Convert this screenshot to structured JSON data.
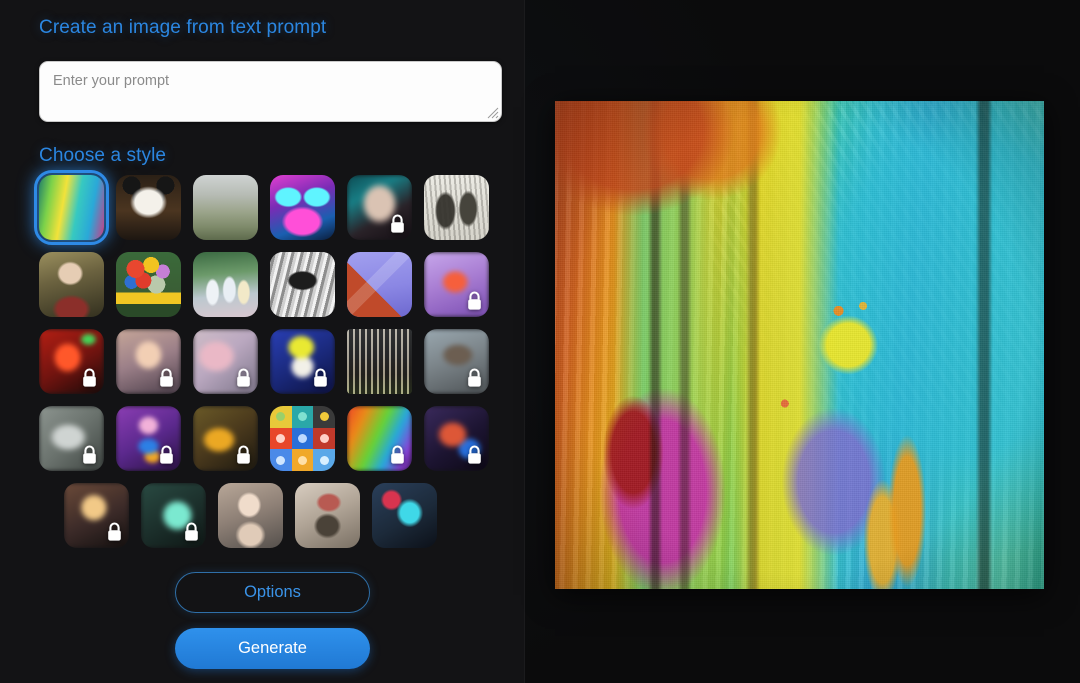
{
  "app": {
    "title": "Create an image from text prompt",
    "background_color": "#0b0b0c",
    "panel_color": "#131315",
    "accent_color": "#2b86e0"
  },
  "prompt": {
    "heading": "Create an image from text prompt",
    "value": "",
    "placeholder": "Enter your prompt",
    "resize_handle_icon": "resize-grip-icon"
  },
  "styles": {
    "heading": "Choose a style",
    "selected_index": 0,
    "lock_icon": "lock-icon",
    "rows": [
      {
        "centered": false,
        "tiles": [
          {
            "name": "abstract-vivid",
            "locked": false,
            "selected": true
          },
          {
            "name": "panda-photo",
            "locked": false,
            "selected": false
          },
          {
            "name": "misty-landscape",
            "locked": false,
            "selected": false
          },
          {
            "name": "neon-robot",
            "locked": false,
            "selected": false
          },
          {
            "name": "dark-portrait",
            "locked": true,
            "selected": false
          },
          {
            "name": "vintage-engraving",
            "locked": false,
            "selected": false
          }
        ]
      },
      {
        "centered": false,
        "tiles": [
          {
            "name": "renaissance-portrait",
            "locked": false,
            "selected": false
          },
          {
            "name": "floral-bouquet",
            "locked": false,
            "selected": false
          },
          {
            "name": "ballet-impressionist",
            "locked": false,
            "selected": false
          },
          {
            "name": "metallic-cup",
            "locked": false,
            "selected": false
          },
          {
            "name": "isometric-3d",
            "locked": false,
            "selected": false
          },
          {
            "name": "pink-fox",
            "locked": true,
            "selected": false
          }
        ]
      },
      {
        "centered": false,
        "tiles": [
          {
            "name": "red-glow-portrait",
            "locked": true,
            "selected": false
          },
          {
            "name": "soft-woman-portrait",
            "locked": true,
            "selected": false
          },
          {
            "name": "pastel-blur",
            "locked": true,
            "selected": false
          },
          {
            "name": "pop-art-face",
            "locked": true,
            "selected": false
          },
          {
            "name": "modern-architecture",
            "locked": false,
            "selected": false
          },
          {
            "name": "muted-still-life",
            "locked": true,
            "selected": false
          }
        ]
      },
      {
        "centered": false,
        "tiles": [
          {
            "name": "grey-texture",
            "locked": true,
            "selected": false
          },
          {
            "name": "neon-jewel-portrait",
            "locked": true,
            "selected": false
          },
          {
            "name": "amber-abstract",
            "locked": true,
            "selected": false
          },
          {
            "name": "icon-set-grid",
            "locked": false,
            "selected": false
          },
          {
            "name": "rainbow-swirl",
            "locked": true,
            "selected": false
          },
          {
            "name": "dark-color-burst",
            "locked": true,
            "selected": false
          }
        ]
      },
      {
        "centered": true,
        "tiles": [
          {
            "name": "golden-haze-portrait",
            "locked": true,
            "selected": false
          },
          {
            "name": "teal-mist-portrait",
            "locked": true,
            "selected": false
          },
          {
            "name": "pale-cg-woman",
            "locked": false,
            "selected": false
          },
          {
            "name": "painter-figure",
            "locked": false,
            "selected": false
          },
          {
            "name": "cyan-red-man",
            "locked": false,
            "selected": false
          }
        ]
      }
    ]
  },
  "actions": {
    "options_label": "Options",
    "generate_label": "Generate"
  },
  "preview": {
    "name": "generated-image-preview",
    "description": "Abstract vivid painting with vertical drips of green, yellow, orange, teal, magenta"
  }
}
